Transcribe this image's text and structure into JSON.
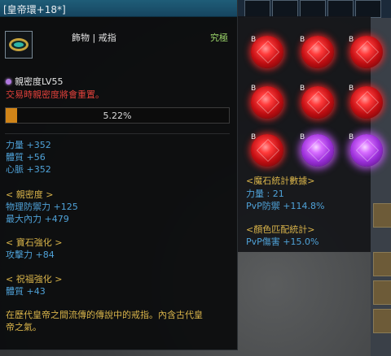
{
  "tooltip": {
    "title": "[皇帝環+18*]",
    "category": "飾物 | 戒指",
    "grade": "究極",
    "bond_label": "親密度LV55",
    "trade_warning": "交易時親密度將會重置。",
    "progress_text": "5.22%",
    "progress_value": 0.0522,
    "base_stats": [
      "力量 +352",
      "體質 +56",
      "心脈 +352"
    ],
    "bond_section": {
      "header": "< 親密度 >",
      "lines": [
        "物理防禦力 +125",
        "最大內力 +479"
      ]
    },
    "gem_section": {
      "header": "< 寶石強化 >",
      "lines": [
        "攻擊力 +84"
      ]
    },
    "bless_section": {
      "header": "< 祝福強化 >",
      "lines": [
        "體質 +43"
      ]
    },
    "description_lines": [
      "在歷代皇帝之間流傳的傳說中的戒指。內含古代皇",
      "帝之氣。"
    ]
  },
  "gem_panel": {
    "badge": "B",
    "gems": [
      "red",
      "red",
      "red",
      "red",
      "red",
      "red",
      "red",
      "purple",
      "purple"
    ],
    "magic_stats_header": "<魔石統計數據>",
    "magic_stats": [
      "力量 : 21",
      "PvP防禦 +114.8%"
    ],
    "color_stats_header": "<顏色匹配統計>",
    "color_stats": [
      "PvP傷害 +15.0%"
    ]
  },
  "colors": {
    "accent_blue": "#4fa2d8",
    "section_gold": "#d9b44a",
    "grade_green": "#9bd46a",
    "warning_red": "#e0403a",
    "progress_orange": "#d08418",
    "title_bar": "#1f5d78"
  }
}
